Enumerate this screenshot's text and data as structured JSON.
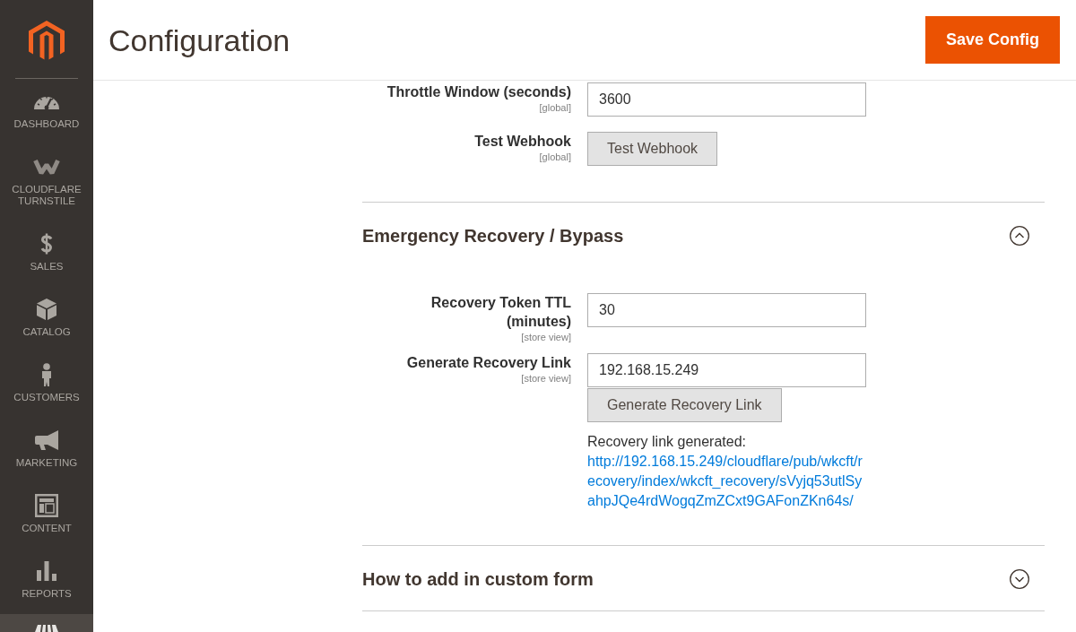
{
  "sidebar": {
    "items": [
      {
        "label": "DASHBOARD",
        "selected": false
      },
      {
        "label": "CLOUDFLARE TURNSTILE",
        "selected": false
      },
      {
        "label": "SALES",
        "selected": false
      },
      {
        "label": "CATALOG",
        "selected": false
      },
      {
        "label": "CUSTOMERS",
        "selected": false
      },
      {
        "label": "MARKETING",
        "selected": false
      },
      {
        "label": "CONTENT",
        "selected": false
      },
      {
        "label": "REPORTS",
        "selected": false
      },
      {
        "selected": true
      }
    ]
  },
  "header": {
    "title": "Configuration",
    "save_button": "Save Config"
  },
  "sections": [
    {
      "rows": [
        {
          "kind": "input",
          "label": "Throttle Window (seconds)",
          "scope": "[global]",
          "value": "3600"
        },
        {
          "kind": "button",
          "label": "Test Webhook",
          "scope": "[global]",
          "button": "Test Webhook"
        }
      ]
    },
    {
      "title": "Emergency Recovery / Bypass",
      "expanded": true,
      "rows": [
        {
          "kind": "input",
          "label": "Recovery Token TTL (minutes)",
          "scope": "[store view]",
          "value": "30"
        },
        {
          "kind": "input",
          "label": "Generate Recovery Link",
          "scope": "[store view]",
          "value": "192.168.15.249",
          "button": "Generate Recovery Link",
          "note": {
            "text": "Recovery link generated:",
            "link": "http://192.168.15.249/cloudflare/pub/wkcft/recovery/index/wkcft_recovery/sVyjq53utlSyahpJQe4rdWogqZmZCxt9GAFonZKn64s/"
          }
        }
      ]
    },
    {
      "title": "How to add in custom form",
      "expanded": false
    }
  ]
}
